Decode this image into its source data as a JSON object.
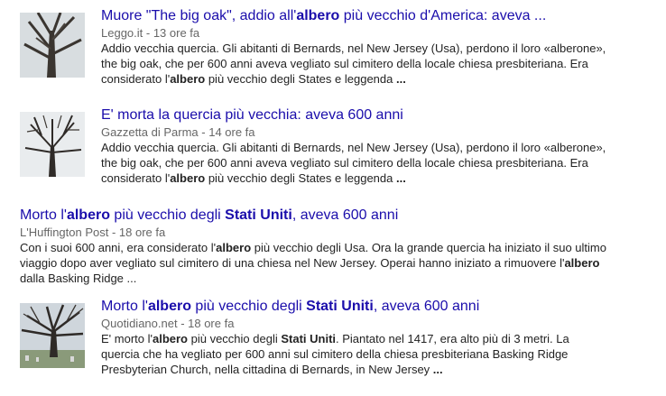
{
  "results": [
    {
      "title_parts": [
        "Muore \"The big oak\", addio all'",
        "albero",
        " più vecchio d'America: aveva ..."
      ],
      "source": "Leggo.it",
      "time": " - 13 ore fa",
      "snippet_lines": [
        [
          "Addio vecchia quercia. Gli abitanti di Bernards, nel New Jersey (Usa), perdono il loro «alberone»,"
        ],
        [
          "the big oak, che per 600 anni aveva vegliato sul cimitero della locale chiesa presbiteriana. Era"
        ],
        [
          "considerato l'",
          "albero",
          " più vecchio degli States e leggenda ",
          "..."
        ]
      ]
    },
    {
      "title_parts": [
        "E' morta la quercia più vecchia: aveva 600 anni"
      ],
      "source": "Gazzetta di Parma",
      "time": " - 14 ore fa",
      "snippet_lines": [
        [
          "Addio vecchia quercia. Gli abitanti di Bernards, nel New Jersey (Usa), perdono il loro «alberone»,"
        ],
        [
          "the big oak, che per 600 anni aveva vegliato sul cimitero della locale chiesa presbiteriana. Era"
        ],
        [
          "considerato l'",
          "albero",
          " più vecchio degli States e leggenda ",
          "..."
        ]
      ]
    },
    {
      "title_parts": [
        "Morto l'",
        "albero",
        " più vecchio degli ",
        "Stati Uniti",
        ", aveva 600 anni"
      ],
      "source": "L'Huffington Post",
      "time": " - 18 ore fa",
      "snippet_lines": [
        [
          "Con i suoi 600 anni, era considerato l'",
          "albero",
          " più vecchio degli Usa. Ora la grande quercia ha iniziato il suo ultimo"
        ],
        [
          "viaggio dopo aver vegliato sul cimitero di una chiesa nel New Jersey. Operai hanno iniziato a rimuovere l'",
          "albero"
        ],
        [
          "dalla Basking Ridge ..."
        ]
      ]
    },
    {
      "title_parts": [
        "Morto l'",
        "albero",
        " più vecchio degli ",
        "Stati Uniti",
        ", aveva 600 anni"
      ],
      "source": "Quotidiano.net",
      "time": " - 18 ore fa",
      "snippet_lines": [
        [
          "E' morto l'",
          "albero",
          " più vecchio degli ",
          "Stati Uniti",
          ". Piantato nel 1417, era alto più di 3 metri. La"
        ],
        [
          "quercia che ha vegliato per 600 anni sul cimitero della chiesa presbiteriana Basking Ridge"
        ],
        [
          "Presbyterian Church, nella cittadina di Bernards, in New Jersey ",
          "..."
        ]
      ]
    }
  ],
  "colors": {
    "link": "#1a0dab",
    "meta": "#666666",
    "text": "#222222"
  }
}
